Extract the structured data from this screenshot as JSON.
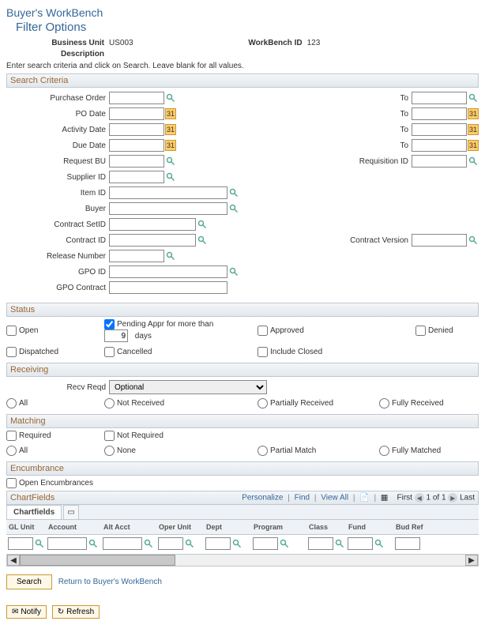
{
  "page": {
    "title": "Buyer's WorkBench",
    "subtitle": "Filter Options"
  },
  "header": {
    "business_unit_label": "Business Unit",
    "business_unit_value": "US003",
    "workbench_id_label": "WorkBench ID",
    "workbench_id_value": "123",
    "description_label": "Description"
  },
  "instruction": "Enter search criteria and click on Search. Leave blank for all values.",
  "sections": {
    "search_criteria": "Search Criteria",
    "status": "Status",
    "receiving": "Receiving",
    "matching": "Matching",
    "encumbrance": "Encumbrance",
    "chartfields": "ChartFields"
  },
  "criteria": {
    "purchase_order": "Purchase Order",
    "po_date": "PO Date",
    "activity_date": "Activity Date",
    "due_date": "Due Date",
    "request_bu": "Request BU",
    "supplier_id": "Supplier ID",
    "item_id": "Item ID",
    "buyer": "Buyer",
    "contract_setid": "Contract SetID",
    "contract_id": "Contract ID",
    "release_number": "Release Number",
    "gpo_id": "GPO ID",
    "gpo_contract": "GPO Contract",
    "to": "To",
    "requisition_id": "Requisition ID",
    "contract_version": "Contract Version"
  },
  "status": {
    "open": "Open",
    "pending": "Pending Appr for more than",
    "pending_days": "9",
    "days": "days",
    "approved": "Approved",
    "denied": "Denied",
    "dispatched": "Dispatched",
    "cancelled": "Cancelled",
    "include_closed": "Include Closed"
  },
  "receiving": {
    "recv_reqd_label": "Recv Reqd",
    "recv_reqd_value": "Optional",
    "all": "All",
    "not_received": "Not Received",
    "partially_received": "Partially Received",
    "fully_received": "Fully Received"
  },
  "matching": {
    "required": "Required",
    "not_required": "Not Required",
    "all": "All",
    "none": "None",
    "partial_match": "Partial Match",
    "fully_matched": "Fully Matched"
  },
  "encumbrance": {
    "open_encumbrances": "Open Encumbrances"
  },
  "chartfields": {
    "tab": "Chartfields",
    "personalize": "Personalize",
    "find": "Find",
    "view_all": "View All",
    "first": "First",
    "pos": "1 of 1",
    "last": "Last",
    "cols": {
      "gl_unit": "GL Unit",
      "account": "Account",
      "alt_acct": "Alt Acct",
      "oper_unit": "Oper Unit",
      "dept": "Dept",
      "program": "Program",
      "class": "Class",
      "fund": "Fund",
      "bud_ref": "Bud Ref"
    }
  },
  "actions": {
    "search": "Search",
    "return": "Return to Buyer's WorkBench",
    "notify": "Notify",
    "refresh": "Refresh"
  }
}
